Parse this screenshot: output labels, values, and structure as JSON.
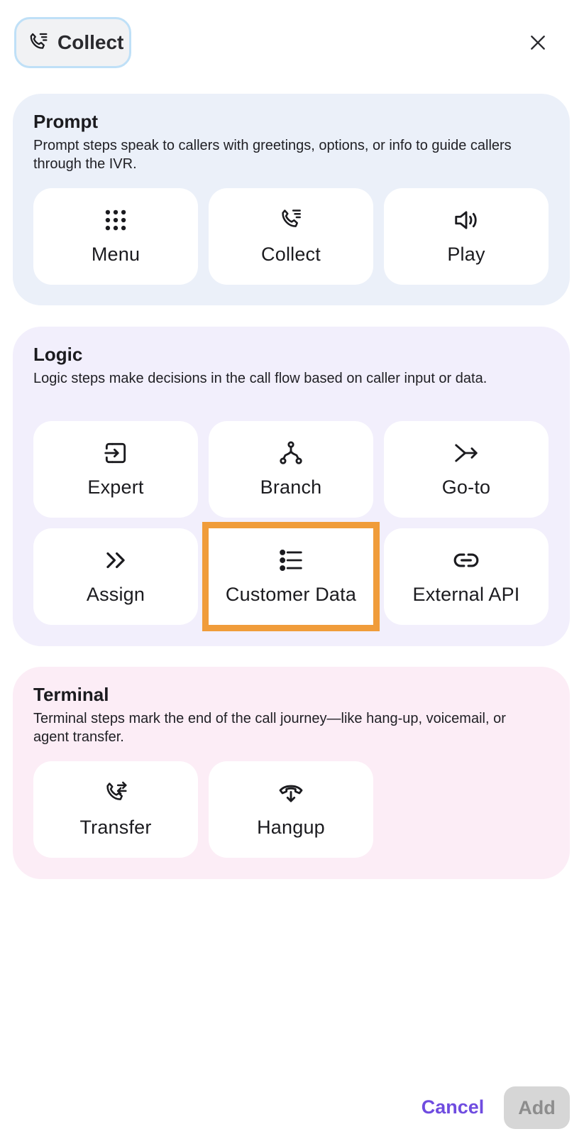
{
  "header": {
    "chip_label": "Collect",
    "chip_icon": "phone-list-icon",
    "close_icon": "close-icon"
  },
  "sections": [
    {
      "title": "Prompt",
      "description": "Prompt steps speak to callers with greetings, options, or info to guide callers through the IVR.",
      "background": "#ebf0f9",
      "tiles": [
        {
          "label": "Menu",
          "icon": "keypad-icon"
        },
        {
          "label": "Collect",
          "icon": "phone-list-icon"
        },
        {
          "label": "Play",
          "icon": "speaker-icon"
        }
      ]
    },
    {
      "title": "Logic",
      "description": "Logic steps make decisions in the call flow based on caller input or data.",
      "background": "#f2effc",
      "tiles": [
        {
          "label": "Expert",
          "icon": "enter-box-icon"
        },
        {
          "label": "Branch",
          "icon": "branch-icon"
        },
        {
          "label": "Go-to",
          "icon": "merge-arrow-icon"
        },
        {
          "label": "Assign",
          "icon": "double-chevron-right-icon"
        },
        {
          "label": "Customer Data",
          "icon": "bullet-list-icon",
          "highlighted": true
        },
        {
          "label": "External API",
          "icon": "link-icon"
        }
      ]
    },
    {
      "title": "Terminal",
      "description": "Terminal steps mark the end of the call journey—like hang-up, voicemail, or agent transfer.",
      "background": "#fcedf6",
      "tiles": [
        {
          "label": "Transfer",
          "icon": "phone-transfer-icon"
        },
        {
          "label": "Hangup",
          "icon": "hangup-icon"
        }
      ]
    }
  ],
  "footer": {
    "cancel_label": "Cancel",
    "add_label": "Add"
  },
  "colors": {
    "accent": "#6f4ce0",
    "highlight": "#f09c3a",
    "disabled_bg": "#d6d6d6",
    "disabled_text": "#8d8d8d"
  }
}
